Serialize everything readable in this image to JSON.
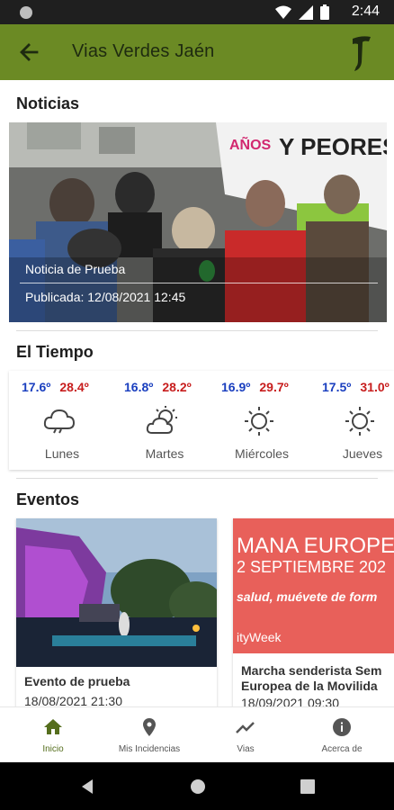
{
  "status_bar": {
    "time": "2:44"
  },
  "app_bar": {
    "title": "Vias Verdes Jaén"
  },
  "sections": {
    "news_title": "Noticias",
    "weather_title": "El Tiempo",
    "events_title": "Eventos"
  },
  "news": {
    "title": "Noticia de Prueba",
    "date": "Publicada: 12/08/2021 12:45",
    "banner_text_1": "AÑOS",
    "banner_text_2": "Y PEORES"
  },
  "weather": [
    {
      "min": "17.6º",
      "max": "28.4º",
      "day": "Lunes",
      "icon": "cloud-icon"
    },
    {
      "min": "16.8º",
      "max": "28.2º",
      "day": "Martes",
      "icon": "partly-cloudy-icon"
    },
    {
      "min": "16.9º",
      "max": "29.7º",
      "day": "Miércoles",
      "icon": "sun-icon"
    },
    {
      "min": "17.5º",
      "max": "31.0º",
      "day": "Jueves",
      "icon": "sun-icon"
    }
  ],
  "events": [
    {
      "title": "Evento de prueba",
      "date": "18/08/2021 21:30"
    },
    {
      "title": "Marcha senderista Semana Europea de la Movilidad",
      "title_line1": "Marcha senderista Sem",
      "title_line2": "Europea de la Movilida",
      "date": "18/09/2021 09:30",
      "banner_line1": "MANA EUROPE",
      "banner_line2": "2 SEPTIEMBRE 202",
      "banner_line3": "salud, muévete de form",
      "banner_line4": "ityWeek"
    }
  ],
  "bottom_nav": [
    {
      "label": "Inicio",
      "icon": "home-icon"
    },
    {
      "label": "Mis Incidencias",
      "icon": "location-pin-icon"
    },
    {
      "label": "Vias",
      "icon": "trend-line-icon"
    },
    {
      "label": "Acerca de",
      "icon": "info-icon"
    }
  ],
  "colors": {
    "app_bar": "#6b8a24",
    "active_nav": "#556e1d",
    "temp_min": "#1a3fbf",
    "temp_max": "#c71d1d"
  }
}
